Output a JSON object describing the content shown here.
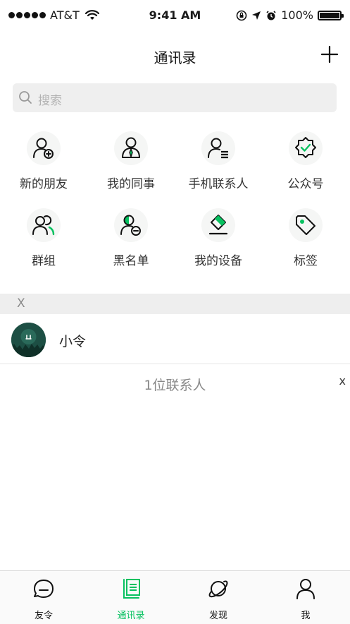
{
  "status_bar": {
    "carrier": "AT&T",
    "time": "9:41 AM",
    "battery": "100%"
  },
  "nav": {
    "title": "通讯录"
  },
  "search": {
    "placeholder": "搜索"
  },
  "entries": [
    {
      "label": "新的朋友",
      "icon": "add-friend-icon"
    },
    {
      "label": "我的同事",
      "icon": "colleague-icon"
    },
    {
      "label": "手机联系人",
      "icon": "phone-contacts-icon"
    },
    {
      "label": "公众号",
      "icon": "official-account-icon"
    },
    {
      "label": "群组",
      "icon": "group-icon"
    },
    {
      "label": "黑名单",
      "icon": "blacklist-icon"
    },
    {
      "label": "我的设备",
      "icon": "device-icon"
    },
    {
      "label": "标签",
      "icon": "tag-icon"
    }
  ],
  "section": {
    "letter": "X"
  },
  "contacts": [
    {
      "name": "小令"
    }
  ],
  "footer": {
    "count": "1位联系人",
    "index_letter": "x"
  },
  "tabs": [
    {
      "label": "友令",
      "icon": "chat-icon",
      "active": false
    },
    {
      "label": "通讯录",
      "icon": "contacts-icon",
      "active": true
    },
    {
      "label": "发现",
      "icon": "discover-icon",
      "active": false
    },
    {
      "label": "我",
      "icon": "me-icon",
      "active": false
    }
  ],
  "colors": {
    "accent": "#07c160",
    "dark": "#111111",
    "section_bg": "#eeeeee"
  }
}
